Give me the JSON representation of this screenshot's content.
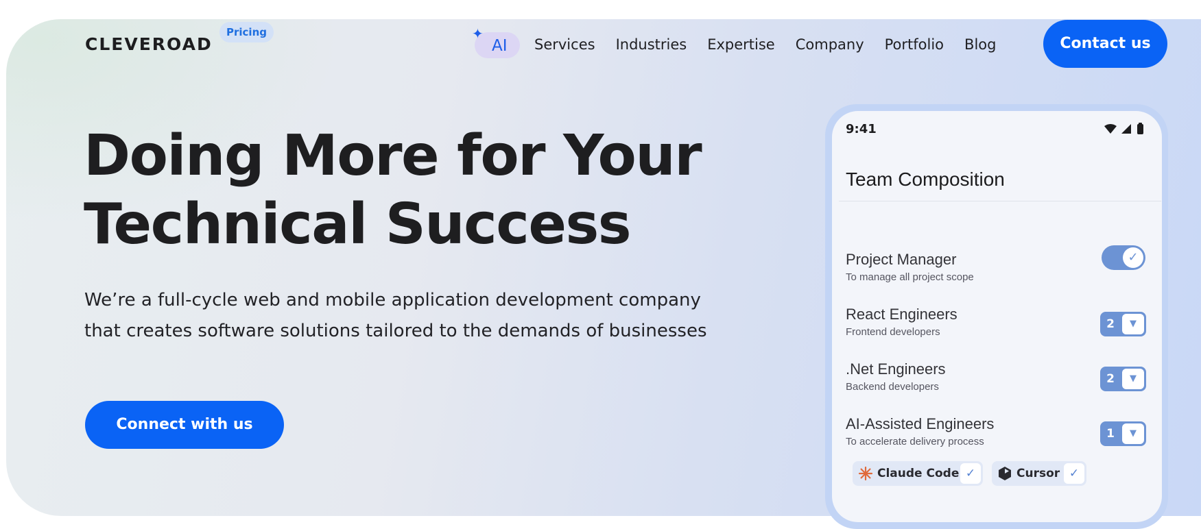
{
  "header": {
    "logo": "CLEVEROAD",
    "pricing_badge": "Pricing",
    "ai_link": "AI",
    "nav": [
      "Services",
      "Industries",
      "Expertise",
      "Company",
      "Portfolio",
      "Blog"
    ],
    "contact_label": "Contact us"
  },
  "hero": {
    "headline_line1": "Doing More for Your",
    "headline_line2": "Technical Success",
    "subhead_line1": "We’re a full-cycle web and mobile application development company",
    "subhead_line2": "that creates software solutions tailored to the demands of businesses",
    "cta_label": "Connect with us"
  },
  "phone": {
    "time": "9:41",
    "title": "Team Composition",
    "roles": [
      {
        "title": "Project Manager",
        "desc": "To manage all project scope",
        "control": "toggle",
        "enabled": true
      },
      {
        "title": "React Engineers",
        "desc": "Frontend developers",
        "control": "stepper",
        "count": "2"
      },
      {
        "title": ".Net Engineers",
        "desc": "Backend developers",
        "control": "stepper",
        "count": "2"
      },
      {
        "title": "AI-Assisted Engineers",
        "desc": "To accelerate delivery process",
        "control": "stepper",
        "count": "1"
      }
    ],
    "tools": [
      {
        "name": "Claude Code",
        "icon": "claude-icon",
        "checked": true
      },
      {
        "name": "Cursor",
        "icon": "cursor-icon",
        "checked": true
      }
    ]
  },
  "colors": {
    "accent": "#0a63f5",
    "control": "#6c93d4",
    "ai_tint": "#dcd6f4",
    "claude_orange": "#e06a3c"
  }
}
